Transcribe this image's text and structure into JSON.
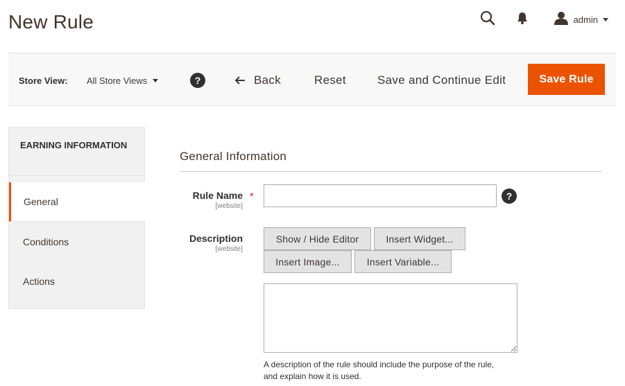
{
  "header": {
    "title": "New Rule",
    "user_name": "admin",
    "icons": [
      "search-icon",
      "bell-icon",
      "user-icon",
      "chevron-down-icon"
    ]
  },
  "toolbar": {
    "store_view_label": "Store View:",
    "store_view_value": "All Store Views",
    "help_glyph": "?",
    "back_label": "Back",
    "reset_label": "Reset",
    "save_continue_label": "Save and Continue Edit",
    "save_rule_label": "Save Rule"
  },
  "sidebar": {
    "title": "EARNING INFORMATION",
    "tabs": [
      {
        "label": "General",
        "active": true
      },
      {
        "label": "Conditions",
        "active": false
      },
      {
        "label": "Actions",
        "active": false
      }
    ]
  },
  "form": {
    "section_title": "General Information",
    "rule_name": {
      "label": "Rule Name",
      "scope": "[website]",
      "required_mark": "*",
      "value": "",
      "help_glyph": "?"
    },
    "description": {
      "label": "Description",
      "scope": "[website]",
      "value": "",
      "buttons": {
        "show_hide": "Show / Hide Editor",
        "widget": "Insert Widget...",
        "image": "Insert Image...",
        "variable": "Insert Variable..."
      },
      "note_line1": "A description of the rule should include the purpose of the rule,",
      "note_line2": "and explain how it is used."
    }
  },
  "colors": {
    "accent": "#eb5202",
    "required": "#e22626",
    "text": "#41362f",
    "toolbar_bg": "#f8f8f8",
    "nav_bg": "#f1f1f1"
  }
}
